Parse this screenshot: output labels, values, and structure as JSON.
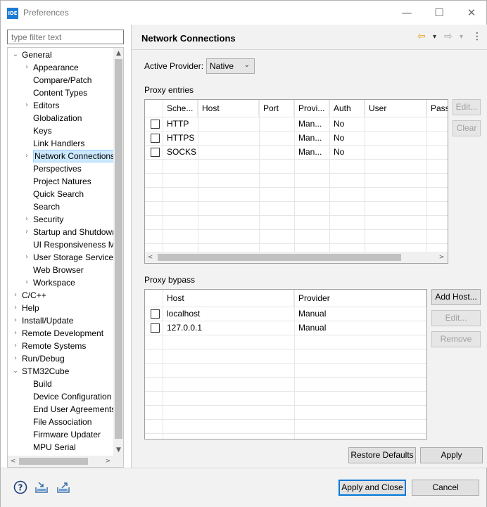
{
  "window": {
    "app_icon_text": "IDE",
    "title": "Preferences",
    "controls": {
      "minimize": "—",
      "maximize": "☐",
      "close": "✕"
    }
  },
  "filter": {
    "placeholder": "type filter text"
  },
  "tree": {
    "items": [
      {
        "label": "General",
        "arrow": "⌄"
      },
      {
        "label": "Appearance",
        "arrow": "›"
      },
      {
        "label": "Compare/Patch",
        "arrow": ""
      },
      {
        "label": "Content Types",
        "arrow": ""
      },
      {
        "label": "Editors",
        "arrow": "›"
      },
      {
        "label": "Globalization",
        "arrow": ""
      },
      {
        "label": "Keys",
        "arrow": ""
      },
      {
        "label": "Link Handlers",
        "arrow": ""
      },
      {
        "label": "Network Connections",
        "arrow": "›"
      },
      {
        "label": "Perspectives",
        "arrow": ""
      },
      {
        "label": "Project Natures",
        "arrow": ""
      },
      {
        "label": "Quick Search",
        "arrow": ""
      },
      {
        "label": "Search",
        "arrow": ""
      },
      {
        "label": "Security",
        "arrow": "›"
      },
      {
        "label": "Startup and Shutdown",
        "arrow": "›"
      },
      {
        "label": "UI Responsiveness Monitoring",
        "arrow": ""
      },
      {
        "label": "User Storage Service",
        "arrow": "›"
      },
      {
        "label": "Web Browser",
        "arrow": ""
      },
      {
        "label": "Workspace",
        "arrow": "›"
      },
      {
        "label": "C/C++",
        "arrow": "›"
      },
      {
        "label": "Help",
        "arrow": "›"
      },
      {
        "label": "Install/Update",
        "arrow": "›"
      },
      {
        "label": "Remote Development",
        "arrow": "›"
      },
      {
        "label": "Remote Systems",
        "arrow": "›"
      },
      {
        "label": "Run/Debug",
        "arrow": "›"
      },
      {
        "label": "STM32Cube",
        "arrow": "⌄"
      },
      {
        "label": "Build",
        "arrow": ""
      },
      {
        "label": "Device Configuration Tool",
        "arrow": ""
      },
      {
        "label": "End User Agreements",
        "arrow": ""
      },
      {
        "label": "File Association",
        "arrow": ""
      },
      {
        "label": "Firmware Updater",
        "arrow": ""
      },
      {
        "label": "MPU Serial",
        "arrow": ""
      }
    ],
    "selected_index": 8
  },
  "page": {
    "title": "Network Connections"
  },
  "nav": {
    "back_icon": "⇦",
    "dropdown": "▾",
    "forward_icon": "⇨",
    "menu_icon": "⋮"
  },
  "provider": {
    "label": "Active Provider:",
    "value": "Native",
    "chevron": "⌄"
  },
  "proxy_entries": {
    "label": "Proxy entries",
    "columns": [
      "Sche...",
      "Host",
      "Port",
      "Provi...",
      "Auth",
      "User",
      "Pass"
    ],
    "rows": [
      {
        "scheme": "HTTP",
        "host": "",
        "port": "",
        "provider": "Man...",
        "auth": "No",
        "user": "",
        "pass": ""
      },
      {
        "scheme": "HTTPS",
        "host": "",
        "port": "",
        "provider": "Man...",
        "auth": "No",
        "user": "",
        "pass": ""
      },
      {
        "scheme": "SOCKS",
        "host": "",
        "port": "",
        "provider": "Man...",
        "auth": "No",
        "user": "",
        "pass": ""
      }
    ],
    "buttons": {
      "edit": "Edit...",
      "clear": "Clear"
    }
  },
  "proxy_bypass": {
    "label": "Proxy bypass",
    "columns": [
      "Host",
      "Provider"
    ],
    "rows": [
      {
        "host": "localhost",
        "provider": "Manual"
      },
      {
        "host": "127.0.0.1",
        "provider": "Manual"
      }
    ],
    "buttons": {
      "add_host": "Add Host...",
      "edit": "Edit...",
      "remove": "Remove"
    }
  },
  "page_buttons": {
    "restore_defaults": "Restore Defaults",
    "apply": "Apply"
  },
  "footer": {
    "help_icon": "?",
    "apply_and_close": "Apply and Close",
    "cancel": "Cancel"
  },
  "scroll_arrows": {
    "up": "▲",
    "down": "▼",
    "left": "<",
    "right": ">"
  },
  "colors": {
    "accent": "#0078d7",
    "selection": "#cce8ff",
    "nav_back": "#e8a317"
  }
}
